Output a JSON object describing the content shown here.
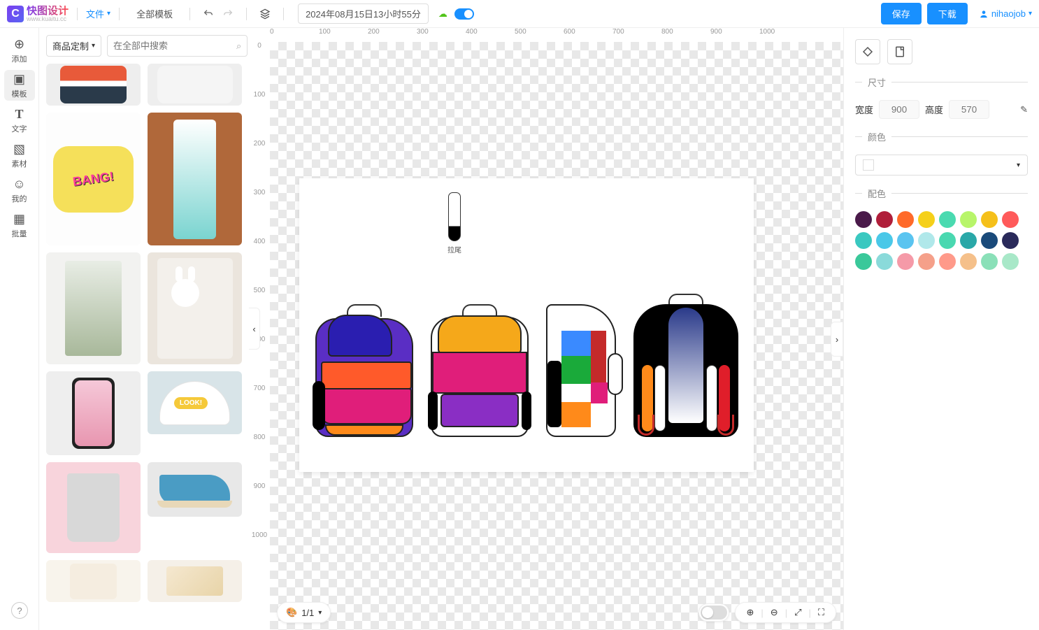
{
  "topbar": {
    "logo_cn": "快图设计",
    "logo_en": "www.kuaitu.cc",
    "file": "文件",
    "all_templates": "全部模板",
    "timestamp": "2024年08月15日13小时55分",
    "save": "保存",
    "download": "下载",
    "user": "nihaojob"
  },
  "leftrail": {
    "add": "添加",
    "template": "模板",
    "text": "文字",
    "asset": "素材",
    "mine": "我的",
    "batch": "批量"
  },
  "panel": {
    "dropdown": "商品定制",
    "search_placeholder": "在全部中搜索"
  },
  "thumbs": {
    "mask": "BANG!",
    "cap": "LOOK!"
  },
  "canvas": {
    "zipper_label": "拉尾",
    "page": "1/1",
    "rulers_h": [
      "0",
      "100",
      "200",
      "300",
      "400",
      "500",
      "600",
      "700",
      "800",
      "900",
      "1000"
    ],
    "rulers_v": [
      "0",
      "100",
      "200",
      "300",
      "400",
      "500",
      "600",
      "700",
      "800",
      "900",
      "1000"
    ]
  },
  "right": {
    "size": "尺寸",
    "width": "宽度",
    "width_val": "900",
    "height": "高度",
    "height_val": "570",
    "color": "颜色",
    "palette_title": "配色",
    "swatches": [
      "#4a1a4a",
      "#b01e3a",
      "#ff6a2a",
      "#f5d01a",
      "#4adab0",
      "#b8f56a",
      "#f5c01a",
      "#ff5a5a",
      "#3ac8c0",
      "#4ac8e8",
      "#5ac4f0",
      "#b0e8ea",
      "#4ad8b0",
      "#2aa8a8",
      "#1a4a7a",
      "#2a2a5a",
      "#3ac89a",
      "#8adada",
      "#f59aa8",
      "#f5a08a",
      "#ff9a8a",
      "#f5c08a",
      "#8ae0b8",
      "#a8e8c8"
    ]
  }
}
